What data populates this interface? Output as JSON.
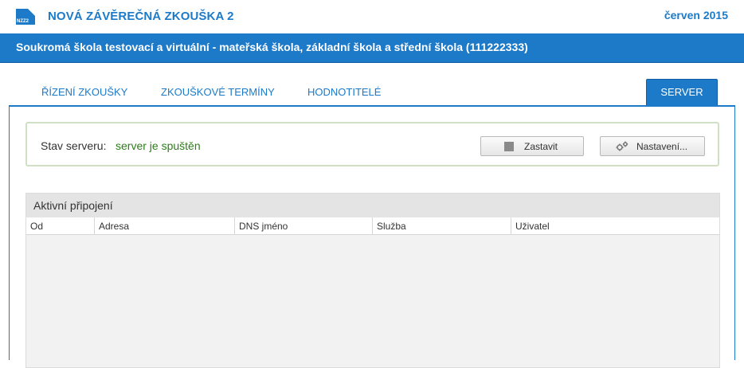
{
  "header": {
    "logo_text": "NZZ2",
    "app_title": "NOVÁ ZÁVĚREČNÁ ZKOUŠKA 2",
    "period": "červen 2015",
    "brand_color": "#1c7ac9"
  },
  "school_bar": {
    "name": "Soukromá škola testovací a virtuální - mateřská škola, základní škola a střední škola (111222333)"
  },
  "tabs": [
    {
      "label": "ŘÍZENÍ ZKOUŠKY",
      "active": false
    },
    {
      "label": "ZKOUŠKOVÉ TERMÍNY",
      "active": false
    },
    {
      "label": "HODNOTITELÉ",
      "active": false
    },
    {
      "label": "SERVER",
      "active": true
    }
  ],
  "server_status": {
    "label": "Stav serveru:",
    "value": "server je spuštěn",
    "value_color": "#2e7d1b",
    "stop_button": {
      "label": "Zastavit",
      "icon": "stop-icon"
    },
    "settings_button": {
      "label": "Nastavení...",
      "icon": "gears-icon"
    }
  },
  "connections": {
    "title": "Aktivní připojení",
    "columns": [
      "Od",
      "Adresa",
      "DNS jméno",
      "Služba",
      "Uživatel"
    ],
    "rows": []
  }
}
